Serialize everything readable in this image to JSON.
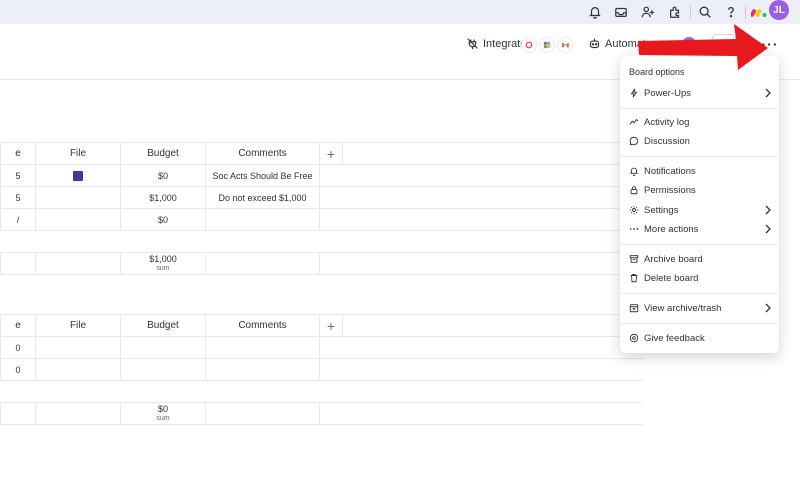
{
  "topbar": {
    "avatar_initials": "JL",
    "icons": [
      "bell-icon",
      "inbox-icon",
      "invite-icon",
      "apps-icon",
      "search-icon",
      "help-icon"
    ]
  },
  "header": {
    "integrate_label": "Integrate",
    "automate_label": "Automate",
    "more_label": "···"
  },
  "table1": {
    "headers": [
      "e",
      "File",
      "Budget",
      "Comments",
      "+"
    ],
    "rows": [
      {
        "c0": "5",
        "budget": "$0",
        "comment": "Soc Acts Should Be Free",
        "file": true
      },
      {
        "c0": "5",
        "budget": "$1,000",
        "comment": "Do not exceed $1,000",
        "file": false
      },
      {
        "c0": "/",
        "budget": "$0",
        "comment": "",
        "file": false
      }
    ],
    "sum_value": "$1,000",
    "sum_label": "sum"
  },
  "table2": {
    "headers": [
      "e",
      "File",
      "Budget",
      "Comments",
      "+"
    ],
    "rows": [
      {
        "c0": "0"
      },
      {
        "c0": "0"
      }
    ],
    "sum_value": "$0",
    "sum_label": "sum"
  },
  "menu": {
    "title": "Board options",
    "items": [
      {
        "label": "Power-Ups",
        "icon": "bolt-icon",
        "submenu": true
      },
      {
        "label": "Activity log",
        "icon": "activity-icon",
        "submenu": false
      },
      {
        "label": "Discussion",
        "icon": "discussion-icon",
        "submenu": false
      },
      {
        "label": "Notifications",
        "icon": "bell-icon",
        "submenu": false
      },
      {
        "label": "Permissions",
        "icon": "lock-icon",
        "submenu": false
      },
      {
        "label": "Settings",
        "icon": "gear-icon",
        "submenu": true
      },
      {
        "label": "More actions",
        "icon": "dots-icon",
        "submenu": true
      },
      {
        "label": "Archive board",
        "icon": "archive-icon",
        "submenu": false
      },
      {
        "label": "Delete board",
        "icon": "trash-icon",
        "submenu": false
      },
      {
        "label": "View archive/trash",
        "icon": "calendar-trash-icon",
        "submenu": true
      },
      {
        "label": "Give feedback",
        "icon": "feedback-icon",
        "submenu": false
      }
    ]
  },
  "colors": {
    "topbar": "#eceff8",
    "avatar": "#9b5de5",
    "arrow": "#e8191c",
    "file_icon": "#3b3b98"
  }
}
